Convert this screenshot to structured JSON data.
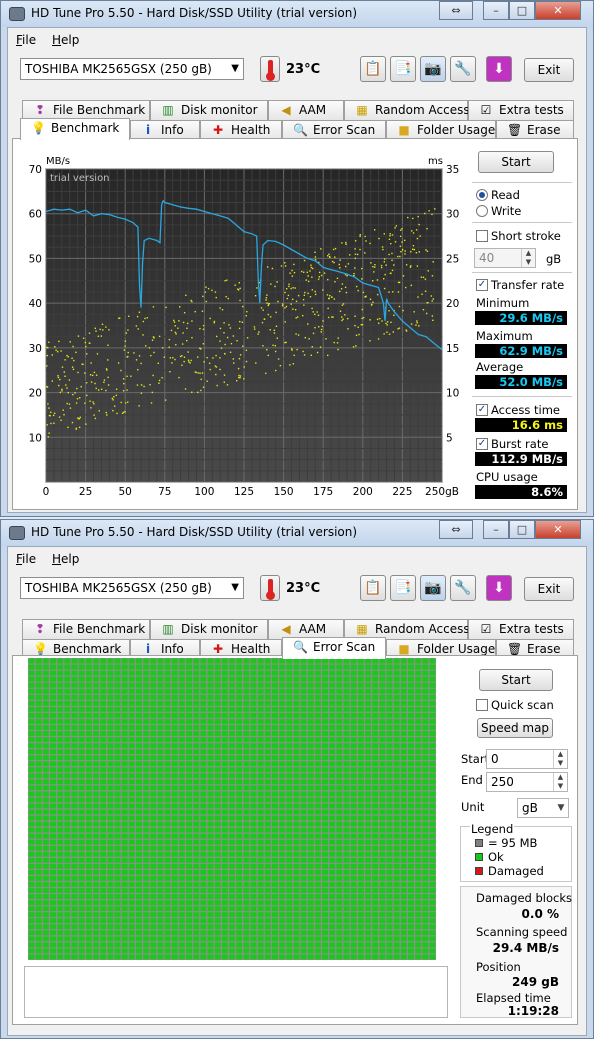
{
  "app": {
    "title": "HD Tune Pro 5.50 - Hard Disk/SSD Utility (trial version)"
  },
  "menu": {
    "file": "File",
    "file_u": "F",
    "file_rest": "ile",
    "help": "Help",
    "help_u": "H",
    "help_rest": "elp"
  },
  "toolbar": {
    "drive": "TOSHIBA MK2565GSX (250 gB)",
    "temperature": "23°C",
    "exit": "Exit"
  },
  "tabs_top": [
    "File Benchmark",
    "Disk monitor",
    "AAM",
    "Random Access",
    "Extra tests"
  ],
  "tabs_bottom": [
    "Benchmark",
    "Info",
    "Health",
    "Error Scan",
    "Folder Usage",
    "Erase"
  ],
  "benchmark": {
    "start": "Start",
    "read": "Read",
    "write": "Write",
    "short_stroke": "Short stroke",
    "stroke_value": "40",
    "stroke_unit": "gB",
    "transfer_rate": "Transfer rate",
    "minimum_label": "Minimum",
    "minimum": "29.6 MB/s",
    "maximum_label": "Maximum",
    "maximum": "62.9 MB/s",
    "average_label": "Average",
    "average": "52.0 MB/s",
    "access_time": "Access time",
    "access_value": "16.6 ms",
    "burst_rate": "Burst rate",
    "burst_value": "112.9 MB/s",
    "cpu_usage": "CPU usage",
    "cpu_value": "8.6%"
  },
  "chart_data": {
    "type": "line",
    "watermark": "trial version",
    "left_unit": "MB/s",
    "right_unit": "ms",
    "x_ticks": [
      "0",
      "25",
      "50",
      "75",
      "100",
      "125",
      "150",
      "175",
      "200",
      "225",
      "250gB"
    ],
    "y_left_ticks": [
      "70",
      "60",
      "50",
      "40",
      "30",
      "20",
      "10"
    ],
    "y_right_ticks": [
      "35",
      "30",
      "25",
      "20",
      "15",
      "10",
      "5"
    ],
    "xlim": [
      0,
      250
    ],
    "ylim_left": [
      0,
      70
    ],
    "ylim_right": [
      0,
      35
    ],
    "grid": true,
    "series": [
      {
        "color": "#2aa7e0",
        "x": [
          0,
          5,
          10,
          15,
          20,
          25,
          30,
          35,
          40,
          45,
          50,
          55,
          58,
          59,
          60,
          61,
          62,
          65,
          70,
          72,
          73,
          74,
          75,
          80,
          85,
          90,
          95,
          100,
          105,
          110,
          115,
          120,
          125,
          130,
          133,
          134,
          135,
          136,
          137,
          140,
          145,
          150,
          155,
          160,
          165,
          170,
          175,
          180,
          185,
          190,
          195,
          200,
          205,
          210,
          213,
          214,
          215,
          216,
          220,
          225,
          230,
          235,
          240,
          245,
          250
        ],
        "y": [
          60.5,
          61,
          60.8,
          61,
          60.2,
          60.8,
          59.5,
          60,
          59.8,
          59.2,
          58.8,
          58,
          57,
          44,
          39,
          49,
          54,
          54.5,
          54,
          53.5,
          62,
          62.9,
          62.5,
          62,
          61.5,
          61.2,
          61,
          60.5,
          60,
          59.5,
          59,
          57.5,
          56,
          55.5,
          55,
          45,
          40,
          48,
          53,
          54,
          53.8,
          53,
          52,
          51,
          50,
          49.5,
          48,
          47.5,
          47,
          46.5,
          45.8,
          44.5,
          44,
          43.5,
          40,
          36,
          41,
          40,
          38,
          36,
          34.5,
          33,
          32.5,
          31,
          29.6
        ]
      },
      {
        "scatter": true,
        "color": "#e5e51a",
        "count": 700,
        "x_range": [
          0,
          245
        ],
        "y_range_ms": [
          5,
          31
        ]
      }
    ]
  },
  "errorscan": {
    "start": "Start",
    "quick_scan": "Quick scan",
    "speed_map": "Speed map",
    "start_label": "Start",
    "start_value": "0",
    "end_label": "End",
    "end_value": "250",
    "unit_label": "Unit",
    "unit_value": "gB",
    "legend_title": "Legend",
    "legend_block": "= 95 MB",
    "legend_ok": "Ok",
    "legend_damaged": "Damaged",
    "damaged_blocks_label": "Damaged blocks",
    "damaged_blocks": "0.0 %",
    "scanning_speed_label": "Scanning speed",
    "scanning_speed": "29.4 MB/s",
    "position_label": "Position",
    "position": "249 gB",
    "elapsed_label": "Elapsed time",
    "elapsed": "1:19:28",
    "grid_rows": 50,
    "grid_cols": 57,
    "ok_color": "#19c919",
    "block_color": "#808080",
    "damaged_color": "#d81818"
  }
}
